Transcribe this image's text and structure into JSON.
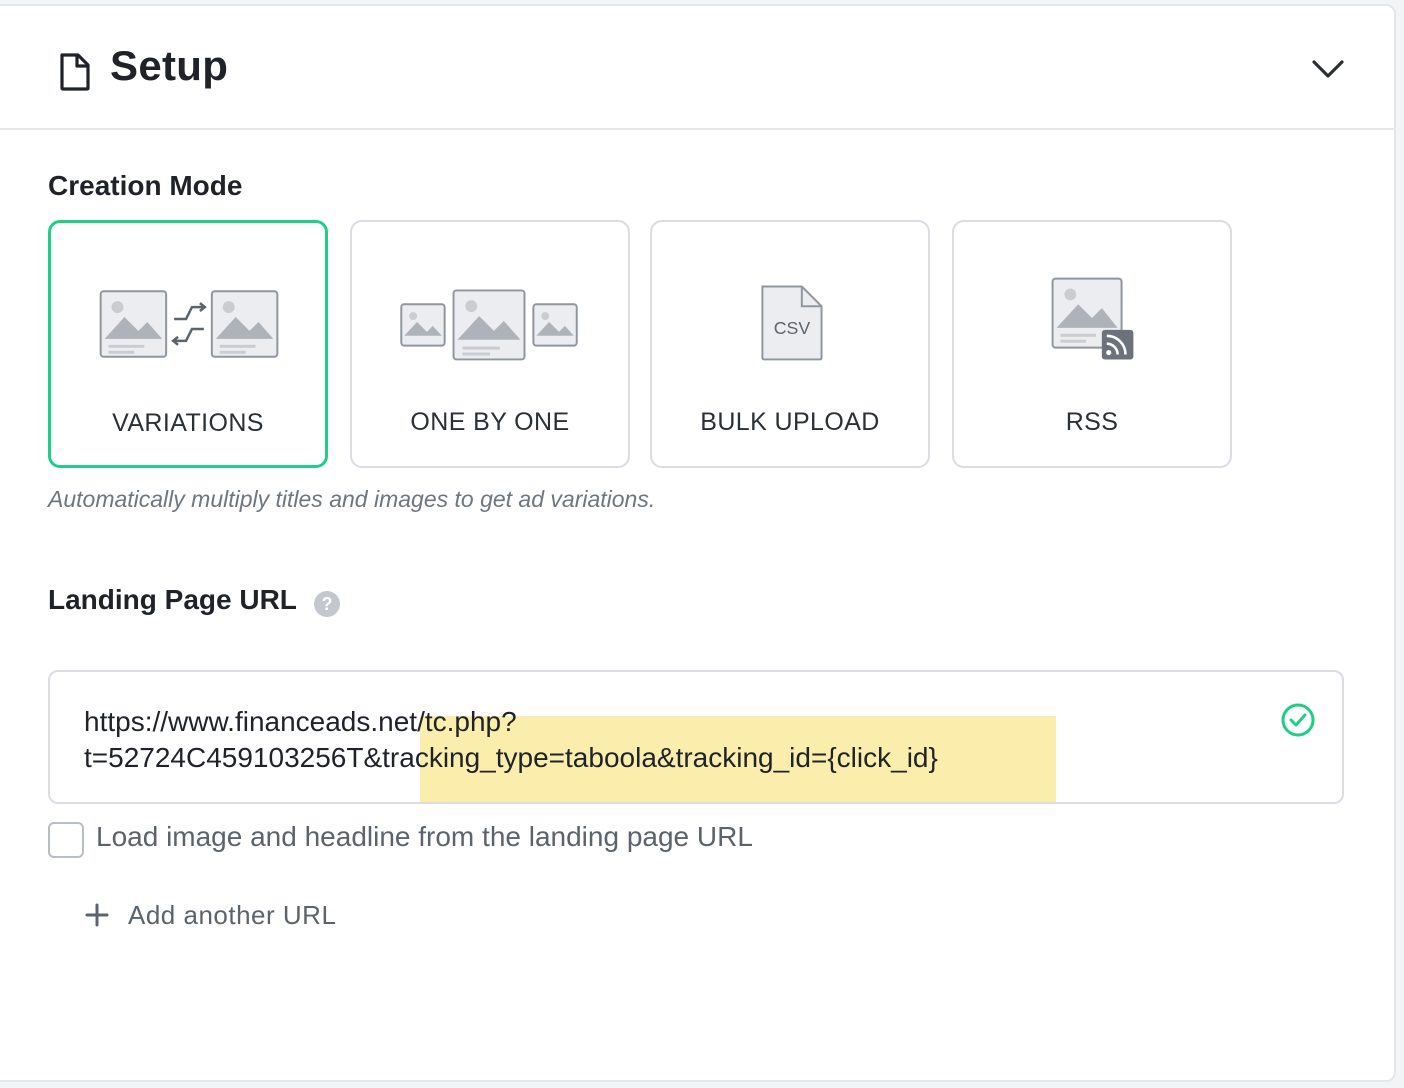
{
  "header": {
    "title": "Setup",
    "icon": "document-icon",
    "collapse_icon": "chevron-down-icon"
  },
  "creation_mode": {
    "label": "Creation Mode",
    "options": [
      {
        "label": "VARIATIONS",
        "icon": "variations-icon",
        "selected": true
      },
      {
        "label": "ONE BY ONE",
        "icon": "one-by-one-icon",
        "selected": false
      },
      {
        "label": "BULK UPLOAD",
        "icon": "csv-file-icon",
        "selected": false,
        "icon_text": "CSV"
      },
      {
        "label": "RSS",
        "icon": "rss-icon",
        "selected": false
      }
    ],
    "hint": "Automatically multiply titles and images to get ad variations.",
    "accent_color": "#1fcf86"
  },
  "landing_page": {
    "label": "Landing Page URL",
    "help_icon": "question-icon",
    "url_line1": "https://www.financeads.net/tc.php?",
    "url_line2": "t=52724C459103256T&tracking_type=taboola&tracking_id={click_id}",
    "highlight_color": "#fbeeac",
    "status_icon": "check-circle-icon",
    "checkbox_label": "Load image and headline from the landing page URL",
    "checkbox_checked": false,
    "add_url_label": "Add another URL"
  }
}
